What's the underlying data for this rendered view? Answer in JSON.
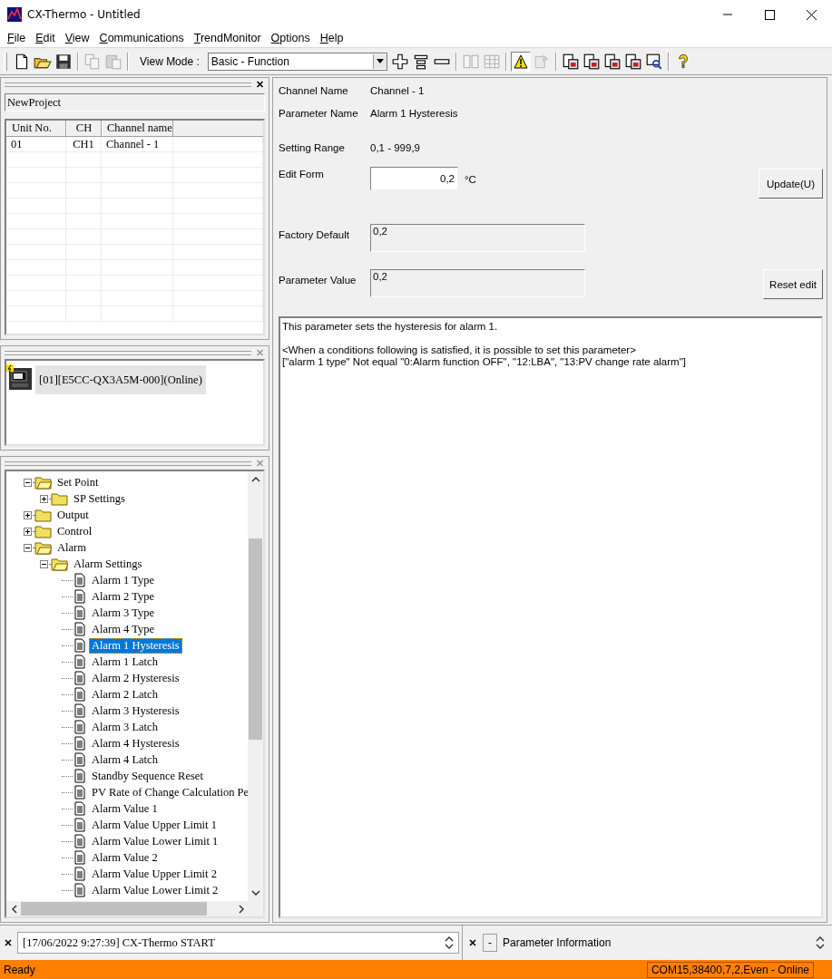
{
  "window": {
    "title": "CX-Thermo - Untitled"
  },
  "menu": [
    "File",
    "Edit",
    "View",
    "Communications",
    "TrendMonitor",
    "Options",
    "Help"
  ],
  "toolbar": [
    {
      "kind": "new",
      "disabled": false,
      "pressed": false
    },
    {
      "kind": "open",
      "disabled": false,
      "pressed": false
    },
    {
      "kind": "save",
      "disabled": false,
      "pressed": false
    },
    {
      "kind": "separator"
    },
    {
      "kind": "copy",
      "disabled": true,
      "pressed": false
    },
    {
      "kind": "paste",
      "disabled": true,
      "pressed": false
    },
    {
      "kind": "separator"
    },
    {
      "kind": "viewmode",
      "label": "View Mode :",
      "value": "Basic - Function"
    },
    {
      "kind": "add",
      "disabled": false,
      "pressed": false
    },
    {
      "kind": "insert",
      "disabled": false,
      "pressed": false
    },
    {
      "kind": "remove",
      "disabled": false,
      "pressed": false
    },
    {
      "kind": "separator"
    },
    {
      "kind": "compare",
      "disabled": true,
      "pressed": false
    },
    {
      "kind": "table",
      "disabled": true,
      "pressed": false
    },
    {
      "kind": "separator"
    },
    {
      "kind": "warning",
      "disabled": false,
      "pressed": true
    },
    {
      "kind": "page",
      "disabled": true,
      "pressed": false
    },
    {
      "kind": "separator"
    },
    {
      "kind": "doc",
      "disabled": false,
      "pressed": false
    },
    {
      "kind": "doc",
      "disabled": false,
      "pressed": false
    },
    {
      "kind": "doc",
      "disabled": false,
      "pressed": false
    },
    {
      "kind": "doc",
      "disabled": false,
      "pressed": false
    },
    {
      "kind": "monitor",
      "disabled": false,
      "pressed": false
    },
    {
      "kind": "separator"
    },
    {
      "kind": "help",
      "disabled": false,
      "pressed": false
    }
  ],
  "project": {
    "name": "NewProject"
  },
  "units_table": {
    "columns": [
      "Unit No.",
      "CH",
      "Channel name"
    ],
    "rows": [
      [
        "01",
        "CH1",
        "Channel - 1"
      ]
    ]
  },
  "device": {
    "label": "[01][E5CC-QX3A5M-000](Online)"
  },
  "tree": [
    {
      "kind": "folder",
      "label": "Set Point",
      "expanded": true,
      "selected": false,
      "children": [
        {
          "kind": "folder",
          "label": "SP Settings",
          "expanded": false,
          "selected": false
        }
      ]
    },
    {
      "kind": "folder",
      "label": "Output",
      "expanded": false,
      "selected": false
    },
    {
      "kind": "folder",
      "label": "Control",
      "expanded": false,
      "selected": false
    },
    {
      "kind": "folder",
      "label": "Alarm",
      "expanded": true,
      "selected": false,
      "children": [
        {
          "kind": "folder",
          "label": "Alarm Settings",
          "expanded": true,
          "selected": false,
          "children": [
            {
              "kind": "parameter",
              "label": "Alarm 1 Type",
              "selected": false
            },
            {
              "kind": "parameter",
              "label": "Alarm 2 Type",
              "selected": false
            },
            {
              "kind": "parameter",
              "label": "Alarm 3 Type",
              "selected": false
            },
            {
              "kind": "parameter",
              "label": "Alarm 4 Type",
              "selected": false
            },
            {
              "kind": "parameter",
              "label": "Alarm 1 Hysteresis",
              "selected": true
            },
            {
              "kind": "parameter",
              "label": "Alarm 1 Latch",
              "selected": false
            },
            {
              "kind": "parameter",
              "label": "Alarm 2 Hysteresis",
              "selected": false
            },
            {
              "kind": "parameter",
              "label": "Alarm 2 Latch",
              "selected": false
            },
            {
              "kind": "parameter",
              "label": "Alarm 3 Hysteresis",
              "selected": false
            },
            {
              "kind": "parameter",
              "label": "Alarm 3 Latch",
              "selected": false
            },
            {
              "kind": "parameter",
              "label": "Alarm 4 Hysteresis",
              "selected": false
            },
            {
              "kind": "parameter",
              "label": "Alarm 4 Latch",
              "selected": false
            },
            {
              "kind": "parameter",
              "label": "Standby Sequence Reset",
              "selected": false
            },
            {
              "kind": "parameter",
              "label": "PV Rate of Change Calculation Pe",
              "selected": false
            },
            {
              "kind": "parameter",
              "label": "Alarm Value 1",
              "selected": false
            },
            {
              "kind": "parameter",
              "label": "Alarm Value Upper Limit 1",
              "selected": false
            },
            {
              "kind": "parameter",
              "label": "Alarm Value Lower Limit 1",
              "selected": false
            },
            {
              "kind": "parameter",
              "label": "Alarm Value 2",
              "selected": false
            },
            {
              "kind": "parameter",
              "label": "Alarm Value Upper Limit 2",
              "selected": false
            },
            {
              "kind": "parameter",
              "label": "Alarm Value Lower Limit 2",
              "selected": false
            }
          ]
        }
      ]
    }
  ],
  "parameter": {
    "channel_name": {
      "label": "Channel Name",
      "value": "Channel - 1"
    },
    "parameter_name": {
      "label": "Parameter Name",
      "value": "Alarm 1 Hysteresis"
    },
    "setting_range": {
      "label": "Setting Range",
      "value": "0,1 - 999,9"
    },
    "edit_form": {
      "label": "Edit Form",
      "value": "0,2",
      "unit": "°C"
    },
    "update_button": "Update(U)",
    "factory_default": {
      "label": "Factory Default",
      "value": "0,2"
    },
    "parameter_value": {
      "label": "Parameter Value",
      "value": "0,2"
    },
    "reset_button": "Reset edit",
    "description": [
      "This parameter sets the hysteresis for alarm 1.",
      "<When a conditions following is satisfied, it is possible to set this parameter>",
      "[\"alarm 1 type\" Not equal \"0:Alarm function OFF\", \"12:LBA\", \"13:PV change rate alarm\"]"
    ]
  },
  "log": {
    "entry": "[17/06/2022 9:27:39] CX-Thermo START"
  },
  "info_panel": {
    "button": "-",
    "title": "Parameter Information"
  },
  "status_bar": {
    "left": "Ready",
    "right": "COM15,38400,7,2,Even - Online"
  }
}
